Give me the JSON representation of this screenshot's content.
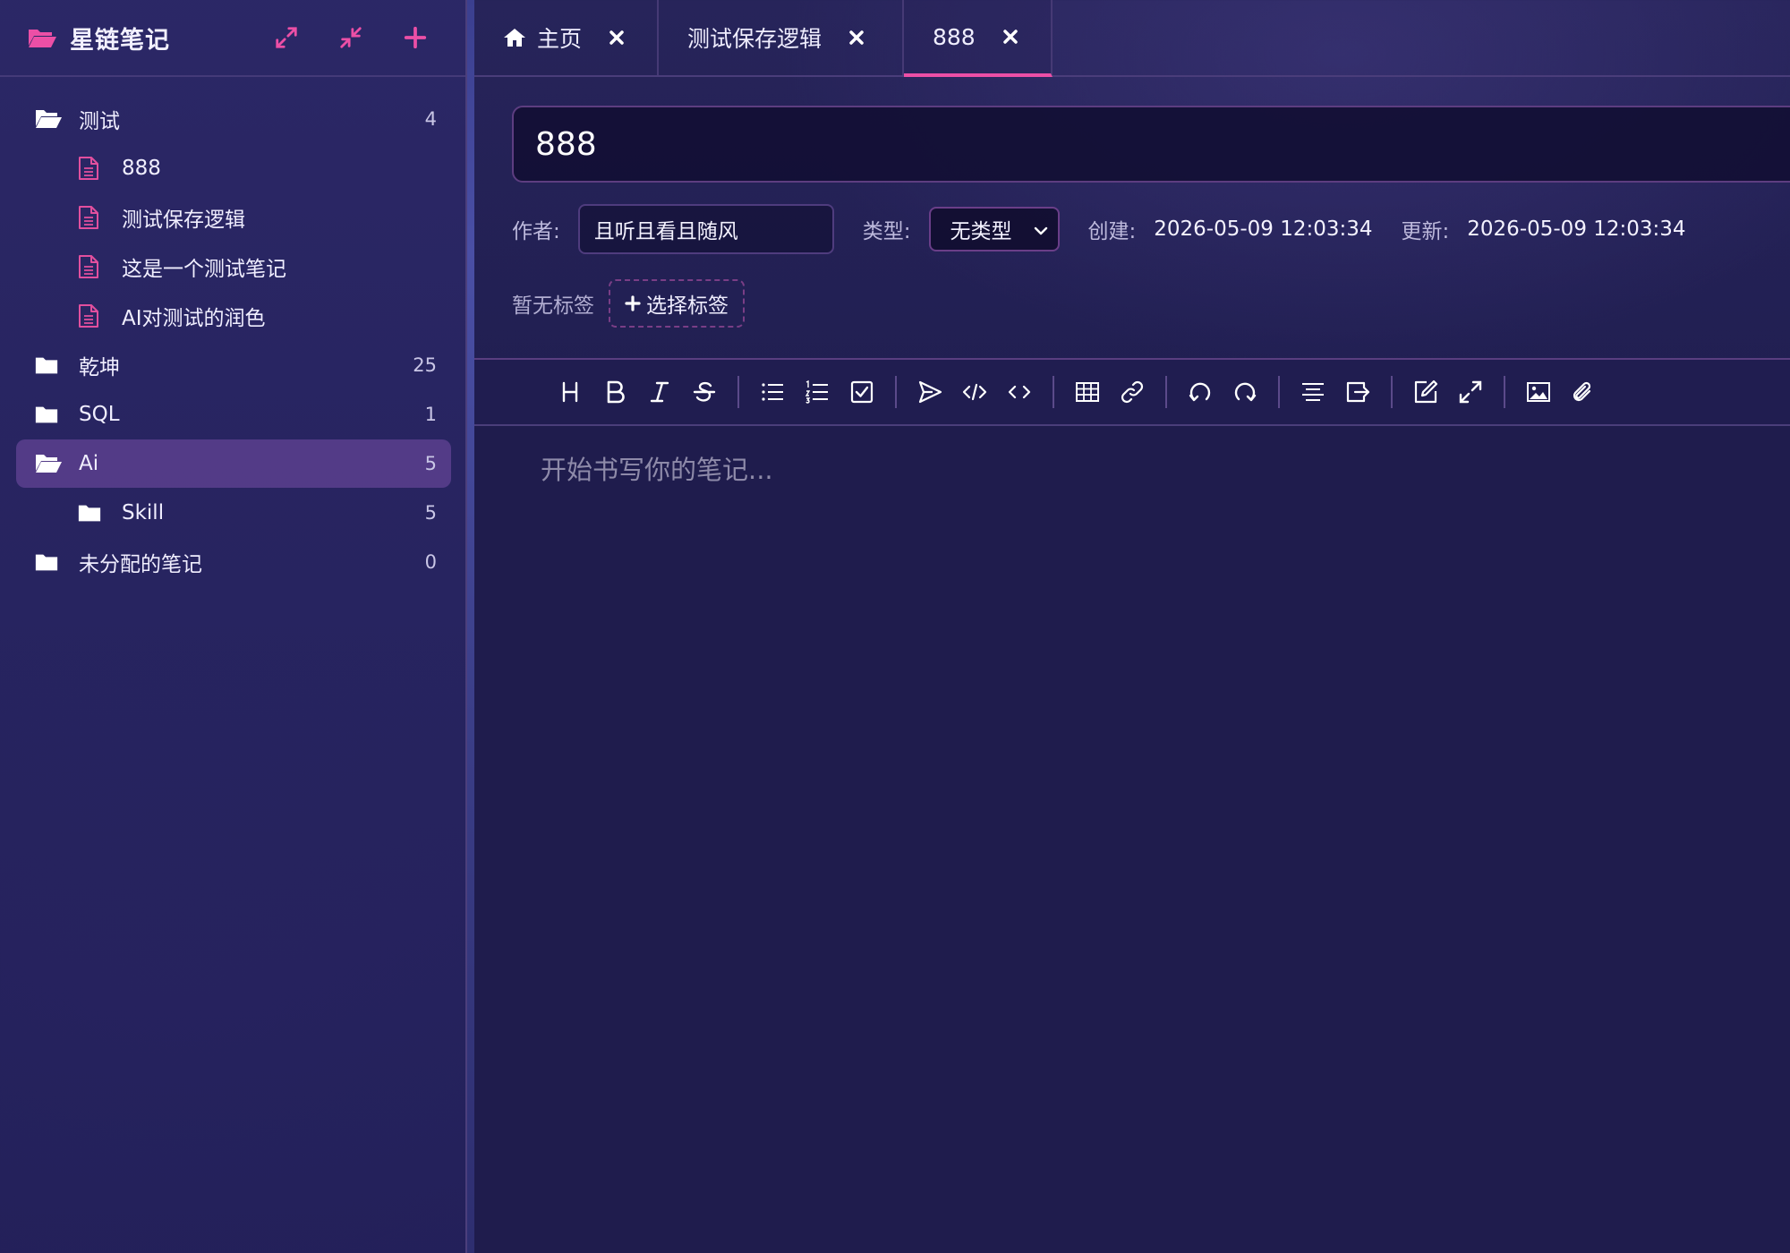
{
  "app": {
    "title": "星链笔记"
  },
  "sidebar": {
    "tree": [
      {
        "label": "测试",
        "count": "4",
        "icon": "folder-open-icon",
        "level": 0
      },
      {
        "label": "888",
        "count": "",
        "icon": "note-icon",
        "level": 1
      },
      {
        "label": "测试保存逻辑",
        "count": "",
        "icon": "note-icon",
        "level": 1
      },
      {
        "label": "这是一个测试笔记",
        "count": "",
        "icon": "note-icon",
        "level": 1
      },
      {
        "label": "AI对测试的润色",
        "count": "",
        "icon": "note-icon",
        "level": 1
      },
      {
        "label": "乾坤",
        "count": "25",
        "icon": "folder-icon",
        "level": 0
      },
      {
        "label": "SQL",
        "count": "1",
        "icon": "folder-icon",
        "level": 0
      },
      {
        "label": "Ai",
        "count": "5",
        "icon": "folder-open-icon",
        "level": 0,
        "active": true
      },
      {
        "label": "Skill",
        "count": "5",
        "icon": "folder-icon",
        "level": 1
      },
      {
        "label": "未分配的笔记",
        "count": "0",
        "icon": "folder-icon",
        "level": 0
      }
    ]
  },
  "tabs": [
    {
      "label": "主页",
      "icon": "home-icon"
    },
    {
      "label": "测试保存逻辑"
    },
    {
      "label": "888",
      "active": true
    }
  ],
  "note": {
    "title": "888",
    "author_label": "作者:",
    "author": "且听且看且随风",
    "type_label": "类型:",
    "type": "无类型",
    "created_label": "创建:",
    "created": "2026-05-09 12:03:34",
    "updated_label": "更新:",
    "updated": "2026-05-09 12:03:34",
    "no_tags": "暂无标签",
    "select_tags": "选择标签",
    "placeholder": "开始书写你的笔记..."
  },
  "colors": {
    "accent": "#ec4fa6",
    "note_icon": "#e24f9e",
    "folder_icon": "#ffffff"
  }
}
